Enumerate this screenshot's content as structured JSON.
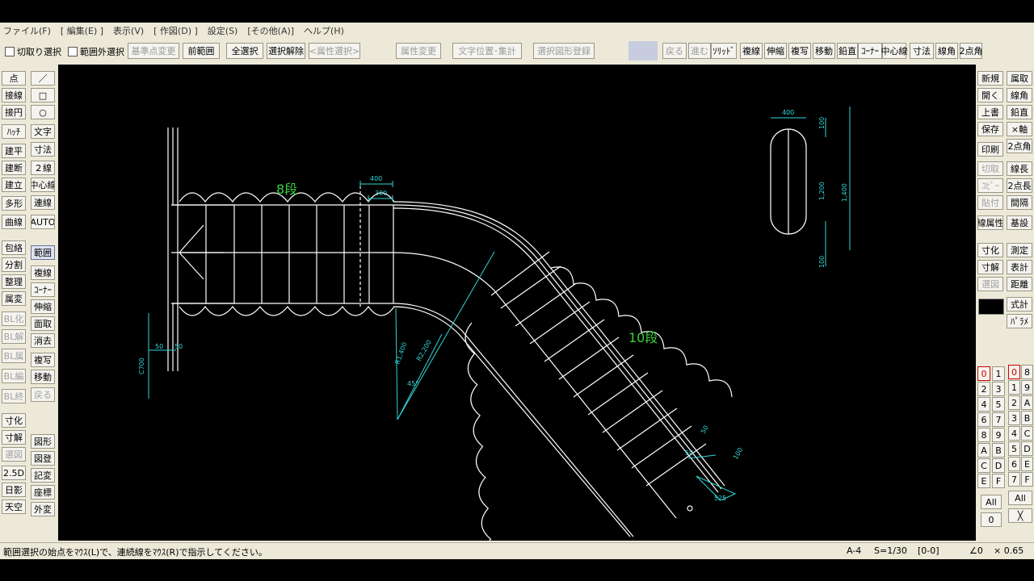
{
  "menu": [
    "ファイル(F)",
    "[ 編集(E) ]",
    "表示(V)",
    "[ 作図(D) ]",
    "設定(S)",
    "[その他(A)]",
    "ヘルプ(H)"
  ],
  "toolbar": {
    "check_cut": "切取り選択",
    "check_outside": "範囲外選択",
    "base_change": "基準点変更",
    "prev_range": "前範囲",
    "select_all": "全選択",
    "deselect": "選択解除",
    "attr_select": "<属性選択>",
    "attr_change": "属性変更",
    "text_pos": "文字位置･集計",
    "register": "選択図形登録",
    "back": "戻る",
    "forward": "進む",
    "solid": "ｿﾘｯﾄﾞ",
    "multi_line": "複線",
    "extend": "伸縮",
    "copy": "複写",
    "move": "移動",
    "vertical": "鉛直",
    "corner": "ｺｰﾅｰ",
    "centerline": "中心線",
    "dimension": "寸法",
    "line_angle": "線角",
    "two_point_angle": "2点角"
  },
  "left_col1": [
    "点",
    "接線",
    "接円",
    "ﾊｯﾁ",
    "建平",
    "建断",
    "建立",
    "多形",
    "曲線",
    "包絡",
    "分割",
    "整理",
    "属変",
    "BL化",
    "BL解",
    "BL属",
    "BL編",
    "BL終",
    "寸化",
    "寸解",
    "選図",
    "2.5D",
    "日影",
    "天空"
  ],
  "left_col2": [
    "／",
    "□",
    "○",
    "文字",
    "寸法",
    "２線",
    "中心線",
    "連線",
    "AUTO",
    "範囲",
    "複線",
    "ｺｰﾅｰ",
    "伸縮",
    "面取",
    "消去",
    "複写",
    "移動",
    "戻る",
    "図形",
    "図登",
    "記変",
    "座標",
    "外変"
  ],
  "right_col1": [
    "新規",
    "開く",
    "上書",
    "保存",
    "印刷",
    "切取",
    "ｺﾋﾟｰ",
    "貼付",
    "線属性",
    "寸化",
    "寸解",
    "選図"
  ],
  "right_col2": [
    "属取",
    "線角",
    "鉛直",
    "×軸",
    "2点角",
    "線長",
    "2点長",
    "間隔",
    "基設",
    "測定",
    "表計",
    "距離",
    "式計",
    "ﾊﾟﾗﾒ"
  ],
  "layers": {
    "groups": [
      "0",
      "1",
      "2",
      "3",
      "4",
      "5",
      "6",
      "7",
      "8",
      "9",
      "A",
      "B",
      "C",
      "D",
      "E",
      "F"
    ],
    "all_label": "All",
    "zero_label": "0",
    "layers_right": [
      "0",
      "8",
      "1",
      "9",
      "2",
      "A",
      "3",
      "B",
      "4",
      "C",
      "5",
      "D",
      "6",
      "E",
      "7",
      "F"
    ],
    "all_right": "All",
    "close_symbol": "╳"
  },
  "drawing": {
    "label_8dan": "8段",
    "label_10dan": "10段",
    "dim_400_top": "400",
    "dim_300_top": "300",
    "dim_r1400": "R1,400",
    "dim_r2200": "R2,200",
    "dim_45": "45°",
    "dim_c700": "C700",
    "dim_50a": "50",
    "dim_50b": "50",
    "dim_50c": "50",
    "dim_50d": "50",
    "dim_100_diag": "100",
    "dim_525": "525",
    "detail_400": "400",
    "detail_100_top": "100",
    "detail_1200": "1,200",
    "detail_1400": "1,400",
    "detail_100_bottom": "100"
  },
  "status": {
    "message": "範囲選択の始点をﾏｳｽ(L)で、連続線をﾏｳｽ(R)で指示してください。",
    "paper": "A-4",
    "scale": "S=1/30",
    "layer": "[0-0]",
    "angle": "∠0",
    "zoom": "× 0.65"
  },
  "colors": {
    "line": "#ffffff",
    "dimension": "#33d6d6",
    "label": "#3cd03c"
  }
}
